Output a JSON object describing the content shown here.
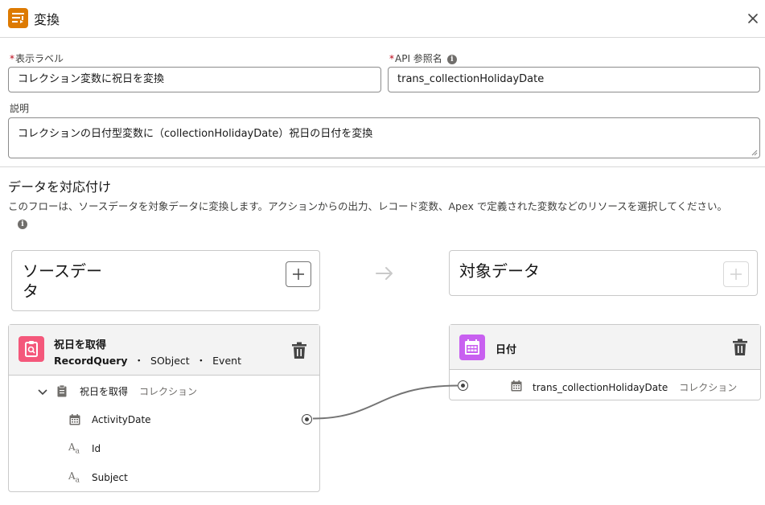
{
  "header": {
    "title": "変換",
    "icon": "transform-icon",
    "close_icon": "close-icon"
  },
  "form": {
    "label_field": {
      "label": "表示ラベル",
      "required": "*",
      "value": "コレクション変数に祝日を変換"
    },
    "api_field": {
      "label": "API 参照名",
      "required": "*",
      "value": "trans_collectionHolidayDate"
    },
    "description_field": {
      "label": "説明",
      "value": "コレクションの日付型変数に（collectionHolidayDate）祝日の日付を変換"
    }
  },
  "mapping": {
    "title": "データを対応付け",
    "description": "このフローは、ソースデータを対象データに変換します。アクションからの出力、レコード変数、Apex で定義された変数などのリソースを選択してください。",
    "source_label": "ソースデー\nタ",
    "target_label": "対象データ"
  },
  "source_card": {
    "title": "祝日を取得",
    "type": "RecordQuery",
    "sep": "・",
    "object_kind": "SObject",
    "object_name": "Event",
    "tree": {
      "label": "祝日を取得",
      "kind": "コレクション",
      "fields": [
        {
          "name": "ActivityDate",
          "icon": "calendar-icon"
        },
        {
          "name": "Id",
          "icon": "text-type-icon"
        },
        {
          "name": "Subject",
          "icon": "text-type-icon"
        }
      ]
    }
  },
  "target_card": {
    "title": "日付",
    "field": {
      "name": "trans_collectionHolidayDate",
      "kind": "コレクション"
    }
  },
  "colors": {
    "header_icon": "#dd7a01",
    "source_icon": "#f4587b",
    "target_icon": "#c860f0",
    "required": "#ba0517"
  }
}
